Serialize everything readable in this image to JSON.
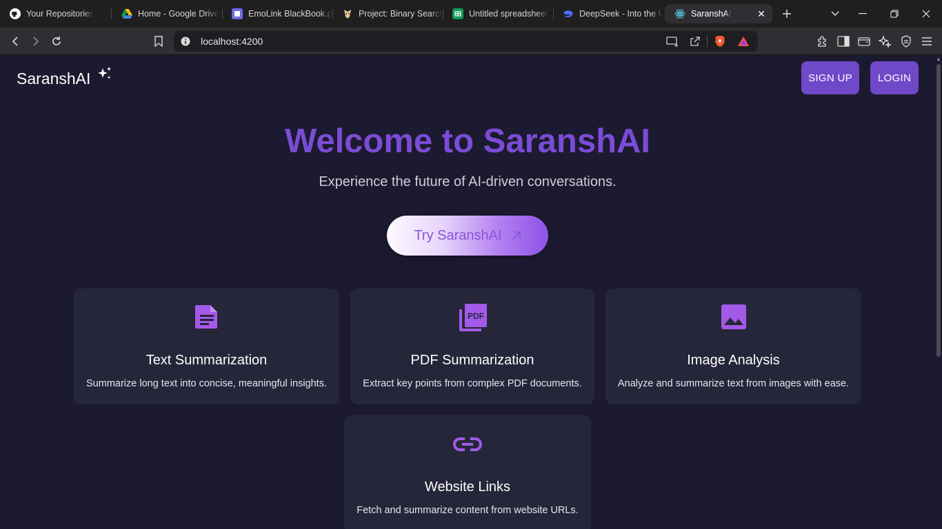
{
  "browser": {
    "tabs": [
      {
        "label": "Your Repositories",
        "icon": "github-icon"
      },
      {
        "label": "Home - Google Drive",
        "icon": "google-drive-icon"
      },
      {
        "label": "EmoLink BlackBook.pdf",
        "icon": "pdf-app-icon"
      },
      {
        "label": "Project: Binary Search",
        "icon": "project-icon"
      },
      {
        "label": "Untitled spreadsheet",
        "icon": "google-sheets-icon"
      },
      {
        "label": "DeepSeek - Into the Unknown",
        "icon": "deepseek-icon"
      },
      {
        "label": "SaranshAI",
        "icon": "react-icon",
        "active": true
      }
    ],
    "url": "localhost:4200"
  },
  "nav": {
    "brand": "SaranshAI",
    "signup": "SIGN UP",
    "login": "LOGIN"
  },
  "hero": {
    "title": "Welcome to SaranshAI",
    "subtitle": "Experience the future of AI-driven conversations.",
    "cta": "Try SaranshAI"
  },
  "features": [
    {
      "title": "Text Summarization",
      "desc": "Summarize long text into concise, meaningful insights.",
      "icon": "document-icon"
    },
    {
      "title": "PDF Summarization",
      "desc": "Extract key points from complex PDF documents.",
      "icon": "pdf-icon",
      "icon_text": "PDF"
    },
    {
      "title": "Image Analysis",
      "desc": "Analyze and summarize text from images with ease.",
      "icon": "image-icon"
    },
    {
      "title": "Website Links",
      "desc": "Fetch and summarize content from website URLs.",
      "icon": "link-icon"
    }
  ],
  "colors": {
    "accent": "#7b4cd6",
    "button": "#7049c9",
    "background": "#1c1a30",
    "card": "#26263a",
    "icon": "#a35ae8"
  }
}
